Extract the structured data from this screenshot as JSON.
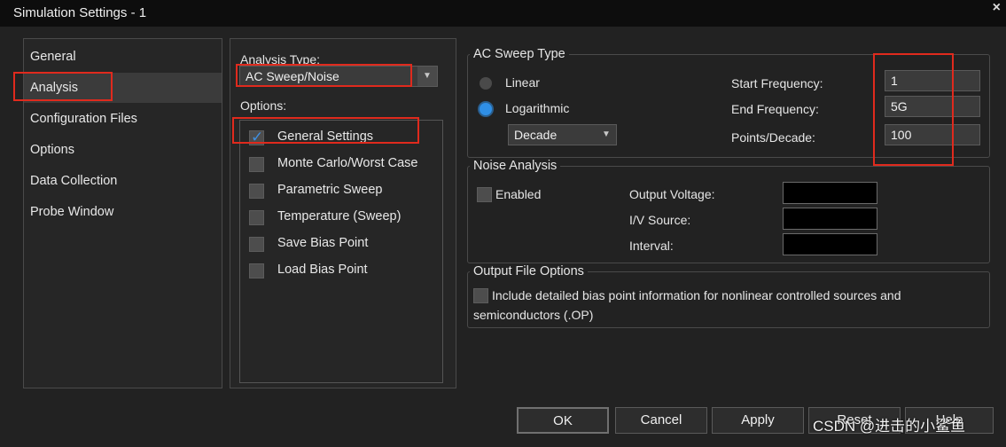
{
  "window": {
    "title": "Simulation Settings - 1",
    "close_glyph": "×"
  },
  "nav": {
    "items": [
      {
        "label": "General"
      },
      {
        "label": "Analysis",
        "selected": true
      },
      {
        "label": "Configuration Files"
      },
      {
        "label": "Options"
      },
      {
        "label": "Data Collection"
      },
      {
        "label": "Probe Window"
      }
    ]
  },
  "analysis": {
    "type_label": "Analysis Type:",
    "type_value": "AC Sweep/Noise",
    "options_label": "Options:",
    "options": [
      {
        "label": "General Settings",
        "checked": true
      },
      {
        "label": "Monte Carlo/Worst Case",
        "checked": false
      },
      {
        "label": "Parametric Sweep",
        "checked": false
      },
      {
        "label": "Temperature (Sweep)",
        "checked": false
      },
      {
        "label": "Save Bias Point",
        "checked": false
      },
      {
        "label": "Load Bias Point",
        "checked": false
      }
    ]
  },
  "ac_sweep": {
    "legend": "AC Sweep Type",
    "linear_label": "Linear",
    "log_label": "Logarithmic",
    "selected": "Logarithmic",
    "scale_value": "Decade",
    "start_label": "Start Frequency:",
    "start_value": "1",
    "end_label": "End Frequency:",
    "end_value": "5G",
    "points_label": "Points/Decade:",
    "points_value": "100"
  },
  "noise": {
    "legend": "Noise Analysis",
    "enabled_label": "Enabled",
    "enabled": false,
    "output_voltage_label": "Output Voltage:",
    "output_voltage_value": "",
    "iv_source_label": "I/V Source:",
    "iv_source_value": "",
    "interval_label": "Interval:",
    "interval_value": ""
  },
  "output_file": {
    "legend": "Output File Options",
    "include_label_line1": "Include detailed bias point information for nonlinear controlled sources and",
    "include_label_line2": "semiconductors (.OP)",
    "checked": false
  },
  "buttons": {
    "ok": "OK",
    "cancel": "Cancel",
    "apply": "Apply",
    "reset": "Reset",
    "help": "Help"
  },
  "watermark": "CSDN @进击的小鲨鱼",
  "colors": {
    "highlight_box": "#e02a1d",
    "radio_on": "#2f8fe6",
    "check": "#3f8fe0"
  }
}
